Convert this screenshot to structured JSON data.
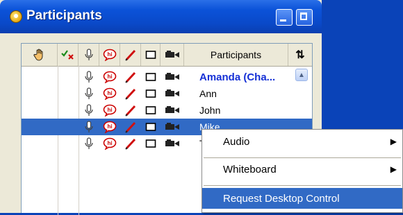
{
  "window": {
    "title": "Participants"
  },
  "header": {
    "participants_label": "Participants",
    "sort_glyph": "⇅"
  },
  "participants": [
    {
      "name": "Amanda (Cha...",
      "role": "chair",
      "selected": false
    },
    {
      "name": "Ann",
      "role": "participant",
      "selected": false
    },
    {
      "name": "John",
      "role": "participant",
      "selected": false
    },
    {
      "name": "Mike",
      "role": "participant",
      "selected": true
    },
    {
      "name": "Te",
      "role": "participant",
      "selected": false
    }
  ],
  "context_menu": {
    "items": [
      {
        "label": "Audio",
        "submenu": true
      },
      {
        "label": "Whiteboard",
        "submenu": true
      },
      {
        "label": "Request Desktop Control",
        "submenu": false,
        "highlighted": true
      }
    ]
  },
  "colors": {
    "selection": "#316ac5",
    "chair_name": "#1530d6",
    "titlebar": "#0b52d8"
  }
}
